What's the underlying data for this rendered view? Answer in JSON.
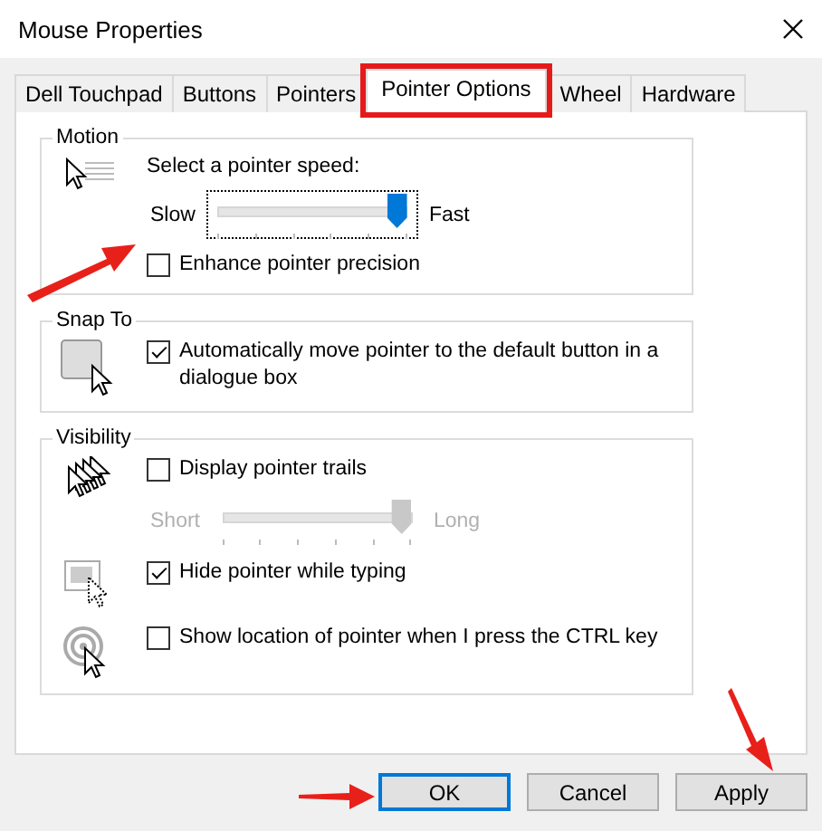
{
  "window": {
    "title": "Mouse Properties"
  },
  "tabs": [
    {
      "label": "Dell Touchpad",
      "selected": false,
      "highlighted": false
    },
    {
      "label": "Buttons",
      "selected": false,
      "highlighted": false
    },
    {
      "label": "Pointers",
      "selected": false,
      "highlighted": false
    },
    {
      "label": "Pointer Options",
      "selected": true,
      "highlighted": true
    },
    {
      "label": "Wheel",
      "selected": false,
      "highlighted": false
    },
    {
      "label": "Hardware",
      "selected": false,
      "highlighted": false
    }
  ],
  "groups": [
    {
      "title": "Motion",
      "rows": [
        {
          "kind": "speed",
          "items": [
            {
              "kind": "text",
              "label": "Select a pointer speed:"
            },
            {
              "kind": "slider",
              "min_label": "Slow",
              "max_label": "Fast",
              "level": 0.95,
              "disabled": false,
              "focused": true
            },
            {
              "kind": "checkbox",
              "label": "Enhance pointer precision",
              "checked": false,
              "arrow": true
            }
          ]
        }
      ]
    },
    {
      "title": "Snap To",
      "rows": [
        {
          "kind": "snap",
          "items": [
            {
              "kind": "checkbox",
              "label": "Automatically move pointer to the default button in a dialogue box",
              "checked": true,
              "arrow": false
            }
          ]
        }
      ]
    },
    {
      "title": "Visibility",
      "rows": [
        {
          "kind": "trails",
          "items": [
            {
              "kind": "checkbox",
              "label": "Display pointer trails",
              "checked": false,
              "arrow": false
            },
            {
              "kind": "slider",
              "min_label": "Short",
              "max_label": "Long",
              "level": 0.95,
              "disabled": true,
              "focused": false
            }
          ]
        },
        {
          "kind": "hide",
          "items": [
            {
              "kind": "checkbox",
              "label": "Hide pointer while typing",
              "checked": true,
              "arrow": false
            }
          ]
        },
        {
          "kind": "location",
          "items": [
            {
              "kind": "checkbox",
              "label": "Show location of pointer when I press the CTRL key",
              "checked": false,
              "arrow": false
            }
          ]
        }
      ]
    }
  ],
  "buttons": [
    {
      "label": "OK",
      "default": true,
      "arrow": true
    },
    {
      "label": "Cancel",
      "default": false,
      "arrow": false
    },
    {
      "label": "Apply",
      "default": false,
      "arrow": true
    }
  ]
}
